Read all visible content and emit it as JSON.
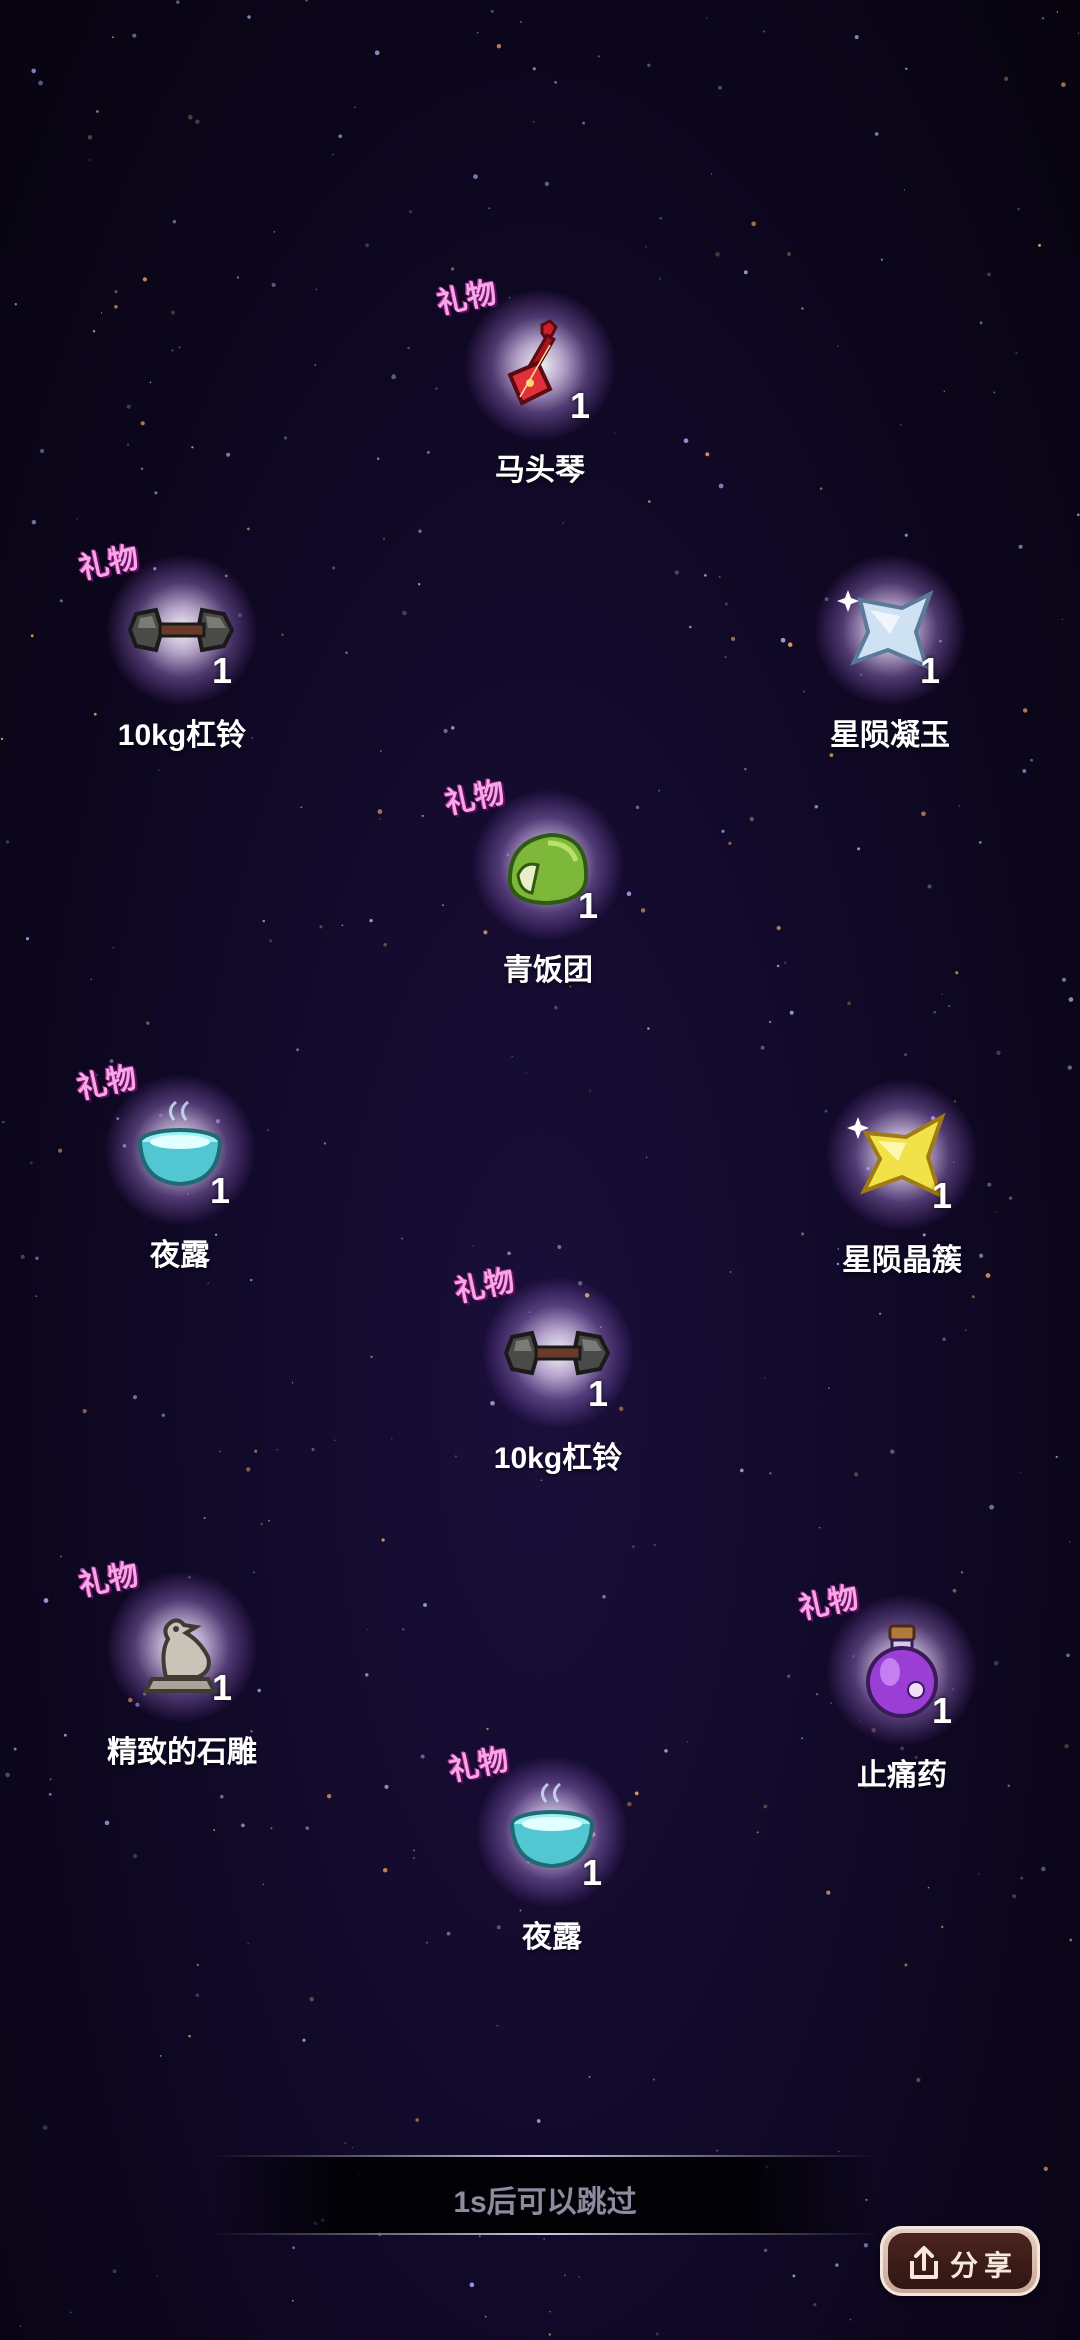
{
  "rewards": [
    {
      "tag": "礼物",
      "count": "1",
      "name": "马头琴",
      "icon": "horsehead-fiddle-icon"
    },
    {
      "tag": "礼物",
      "count": "1",
      "name": "10kg杠铃",
      "icon": "dumbbell-icon"
    },
    {
      "tag": "",
      "count": "1",
      "name": "星陨凝玉",
      "icon": "silver-star-icon"
    },
    {
      "tag": "礼物",
      "count": "1",
      "name": "青饭团",
      "icon": "green-rice-ball-icon"
    },
    {
      "tag": "礼物",
      "count": "1",
      "name": "夜露",
      "icon": "dew-bowl-icon"
    },
    {
      "tag": "",
      "count": "1",
      "name": "星陨晶簇",
      "icon": "gold-star-icon"
    },
    {
      "tag": "礼物",
      "count": "1",
      "name": "10kg杠铃",
      "icon": "dumbbell-icon"
    },
    {
      "tag": "礼物",
      "count": "1",
      "name": "精致的石雕",
      "icon": "stone-bird-statue-icon"
    },
    {
      "tag": "礼物",
      "count": "1",
      "name": "止痛药",
      "icon": "potion-bottle-icon"
    },
    {
      "tag": "礼物",
      "count": "1",
      "name": "夜露",
      "icon": "dew-bowl-icon"
    }
  ],
  "skip": {
    "text": "1s后可以跳过"
  },
  "share": {
    "label": "分享",
    "icon": "share-icon"
  }
}
